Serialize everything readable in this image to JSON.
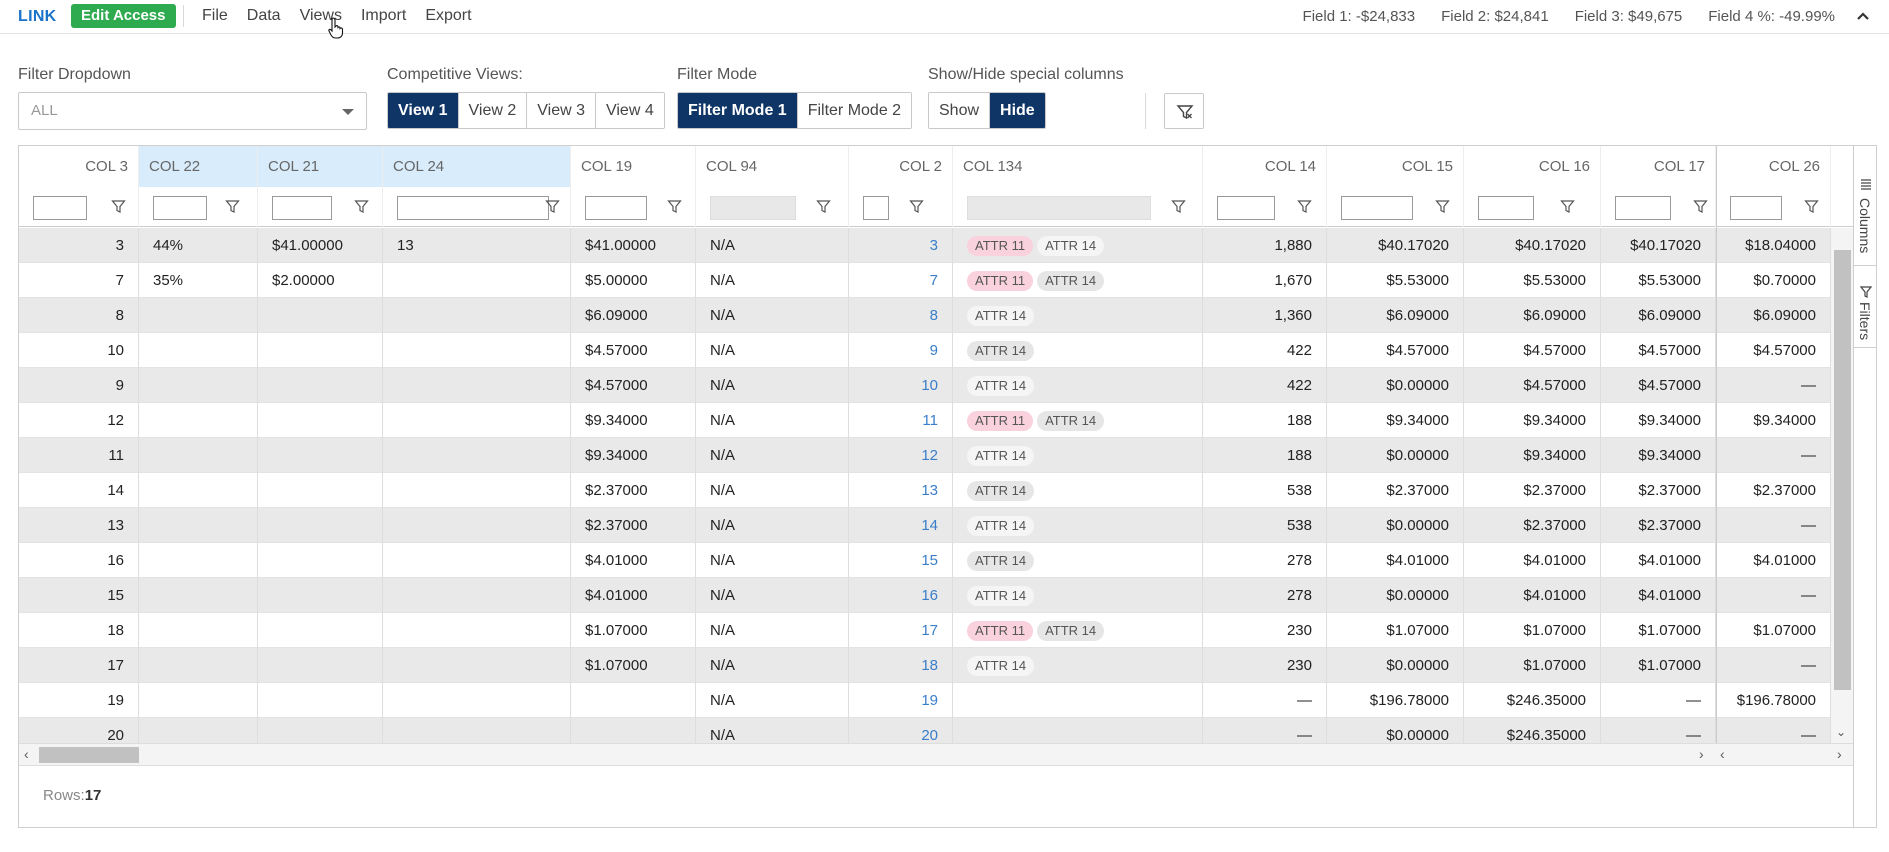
{
  "topbar": {
    "brand": "LINK",
    "edit_access_label": "Edit Access",
    "menu": [
      "File",
      "Data",
      "Views",
      "Import",
      "Export"
    ],
    "fields": [
      "Field 1: -$24,833",
      "Field 2: $24,841",
      "Field 3: $49,675",
      "Field 4 %: -49.99%"
    ]
  },
  "filters": {
    "dropdown_label": "Filter Dropdown",
    "dropdown_value": "ALL",
    "competitive_label": "Competitive Views:",
    "views": [
      "View 1",
      "View 2",
      "View 3",
      "View 4"
    ],
    "active_view": "View 1",
    "mode_label": "Filter Mode",
    "modes": [
      "Filter Mode 1",
      "Filter Mode 2"
    ],
    "active_mode": "Filter Mode 1",
    "special_label": "Show/Hide special columns",
    "special": [
      "Show",
      "Hide"
    ],
    "active_special": "Hide"
  },
  "grid": {
    "columns": [
      "COL 3",
      "COL 22",
      "COL 21",
      "COL 24",
      "COL 19",
      "COL 94",
      "COL 2",
      "COL 134",
      "COL 14",
      "COL 15",
      "COL 16",
      "COL 17",
      "COL 26"
    ],
    "rows": [
      [
        "3",
        "44%",
        "$41.00000",
        "13",
        "$41.00000",
        "N/A",
        "3",
        [
          "ATTR 11",
          "ATTR 14"
        ],
        "1,880",
        "$40.17020",
        "$40.17020",
        "$40.17020",
        "$18.04000"
      ],
      [
        "7",
        "35%",
        "$2.00000",
        "",
        "$5.00000",
        "N/A",
        "7",
        [
          "ATTR 11",
          "ATTR 14"
        ],
        "1,670",
        "$5.53000",
        "$5.53000",
        "$5.53000",
        "$0.70000"
      ],
      [
        "8",
        "",
        "",
        "",
        "$6.09000",
        "N/A",
        "8",
        [
          "ATTR 14"
        ],
        "1,360",
        "$6.09000",
        "$6.09000",
        "$6.09000",
        "$6.09000"
      ],
      [
        "10",
        "",
        "",
        "",
        "$4.57000",
        "N/A",
        "9",
        [
          "ATTR 14"
        ],
        "422",
        "$4.57000",
        "$4.57000",
        "$4.57000",
        "$4.57000"
      ],
      [
        "9",
        "",
        "",
        "",
        "$4.57000",
        "N/A",
        "10",
        [
          "ATTR 14"
        ],
        "422",
        "$0.00000",
        "$4.57000",
        "$4.57000",
        "—"
      ],
      [
        "12",
        "",
        "",
        "",
        "$9.34000",
        "N/A",
        "11",
        [
          "ATTR 11",
          "ATTR 14"
        ],
        "188",
        "$9.34000",
        "$9.34000",
        "$9.34000",
        "$9.34000"
      ],
      [
        "11",
        "",
        "",
        "",
        "$9.34000",
        "N/A",
        "12",
        [
          "ATTR 14"
        ],
        "188",
        "$0.00000",
        "$9.34000",
        "$9.34000",
        "—"
      ],
      [
        "14",
        "",
        "",
        "",
        "$2.37000",
        "N/A",
        "13",
        [
          "ATTR 14"
        ],
        "538",
        "$2.37000",
        "$2.37000",
        "$2.37000",
        "$2.37000"
      ],
      [
        "13",
        "",
        "",
        "",
        "$2.37000",
        "N/A",
        "14",
        [
          "ATTR 14"
        ],
        "538",
        "$0.00000",
        "$2.37000",
        "$2.37000",
        "—"
      ],
      [
        "16",
        "",
        "",
        "",
        "$4.01000",
        "N/A",
        "15",
        [
          "ATTR 14"
        ],
        "278",
        "$4.01000",
        "$4.01000",
        "$4.01000",
        "$4.01000"
      ],
      [
        "15",
        "",
        "",
        "",
        "$4.01000",
        "N/A",
        "16",
        [
          "ATTR 14"
        ],
        "278",
        "$0.00000",
        "$4.01000",
        "$4.01000",
        "—"
      ],
      [
        "18",
        "",
        "",
        "",
        "$1.07000",
        "N/A",
        "17",
        [
          "ATTR 11",
          "ATTR 14"
        ],
        "230",
        "$1.07000",
        "$1.07000",
        "$1.07000",
        "$1.07000"
      ],
      [
        "17",
        "",
        "",
        "",
        "$1.07000",
        "N/A",
        "18",
        [
          "ATTR 14"
        ],
        "230",
        "$0.00000",
        "$1.07000",
        "$1.07000",
        "—"
      ],
      [
        "19",
        "",
        "",
        "",
        "",
        "N/A",
        "19",
        [],
        "—",
        "$196.78000",
        "$246.35000",
        "—",
        "$196.78000"
      ],
      [
        "20",
        "",
        "",
        "",
        "",
        "N/A",
        "20",
        [],
        "—",
        "$0.00000",
        "$246.35000",
        "—",
        "—"
      ]
    ],
    "side_tabs": [
      "Columns",
      "Filters"
    ],
    "footer_label": "Rows:",
    "footer_count": "17"
  },
  "colors": {
    "primary": "#0e3566",
    "success": "#2eaa4f",
    "link": "#3a7ec9",
    "highlight": "#d8ecfb",
    "badge_pink": "#f9d2de"
  }
}
